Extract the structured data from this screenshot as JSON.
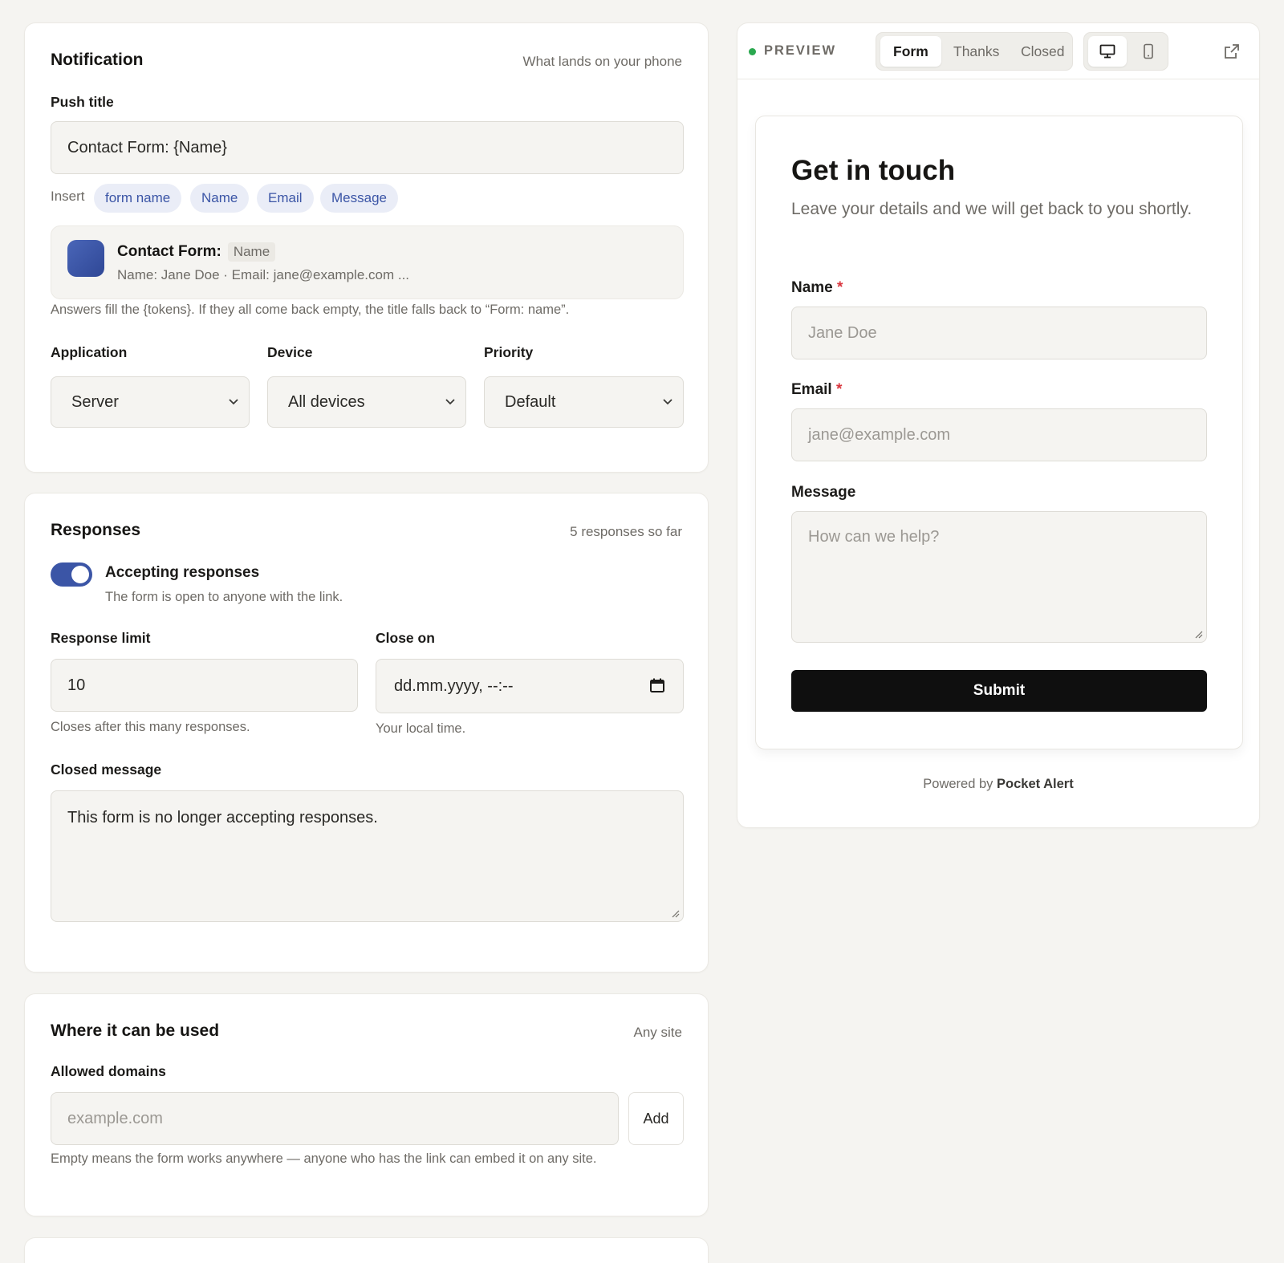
{
  "notification": {
    "title": "Notification",
    "hint": "What lands on your phone",
    "push_title_label": "Push title",
    "push_title_value": "Contact Form: {Name}",
    "insert_label": "Insert",
    "insert_chips": [
      "form name",
      "Name",
      "Email",
      "Message"
    ],
    "preview_title": "Contact Form:",
    "preview_token": "Name",
    "preview_body": "Name: Jane Doe · Email: jane@example.com ...",
    "tokens_help": "Answers fill the {tokens}. If they all come back empty, the title falls back to “Form: name”.",
    "application_label": "Application",
    "application_value": "Server",
    "device_label": "Device",
    "device_value": "All devices",
    "priority_label": "Priority",
    "priority_value": "Default",
    "app_icon_color": "#3b55a6"
  },
  "responses": {
    "title": "Responses",
    "hint": "5 responses so far",
    "toggle_label": "Accepting responses",
    "toggle_on": true,
    "toggle_help": "The form is open to anyone with the link.",
    "limit_label": "Response limit",
    "limit_value": "10",
    "limit_help": "Closes after this many responses.",
    "close_on_label": "Close on",
    "close_on_value": "dd.mm.yyyy, --:--",
    "close_on_help": "Your local time.",
    "closed_message_label": "Closed message",
    "closed_message_value": "This form is no longer accepting responses."
  },
  "domains": {
    "title": "Where it can be used",
    "hint": "Any site",
    "allowed_label": "Allowed domains",
    "input_placeholder": "example.com",
    "add_label": "Add",
    "help": "Empty means the form works anywhere — anyone who has the link can embed it on any site."
  },
  "preview": {
    "status_label": "PREVIEW",
    "status_color": "#2aa84f",
    "tabs": [
      "Form",
      "Thanks",
      "Closed"
    ],
    "active_tab": "Form",
    "device_icons": [
      "desktop-icon",
      "mobile-icon"
    ],
    "open_icon": "external-link-icon",
    "form": {
      "heading": "Get in touch",
      "subheading": "Leave your details and we will get back to you shortly.",
      "name_label": "Name",
      "name_placeholder": "Jane Doe",
      "email_label": "Email",
      "email_placeholder": "jane@example.com",
      "required_mark": "*",
      "message_label": "Message",
      "message_placeholder": "How can we help?",
      "submit_label": "Submit"
    },
    "powered_by_prefix": "Powered by",
    "powered_by_brand": "Pocket Alert"
  },
  "colors": {
    "accent": "#3b55a6",
    "required": "#d9363e",
    "submit_bg": "#0f0f0f"
  }
}
